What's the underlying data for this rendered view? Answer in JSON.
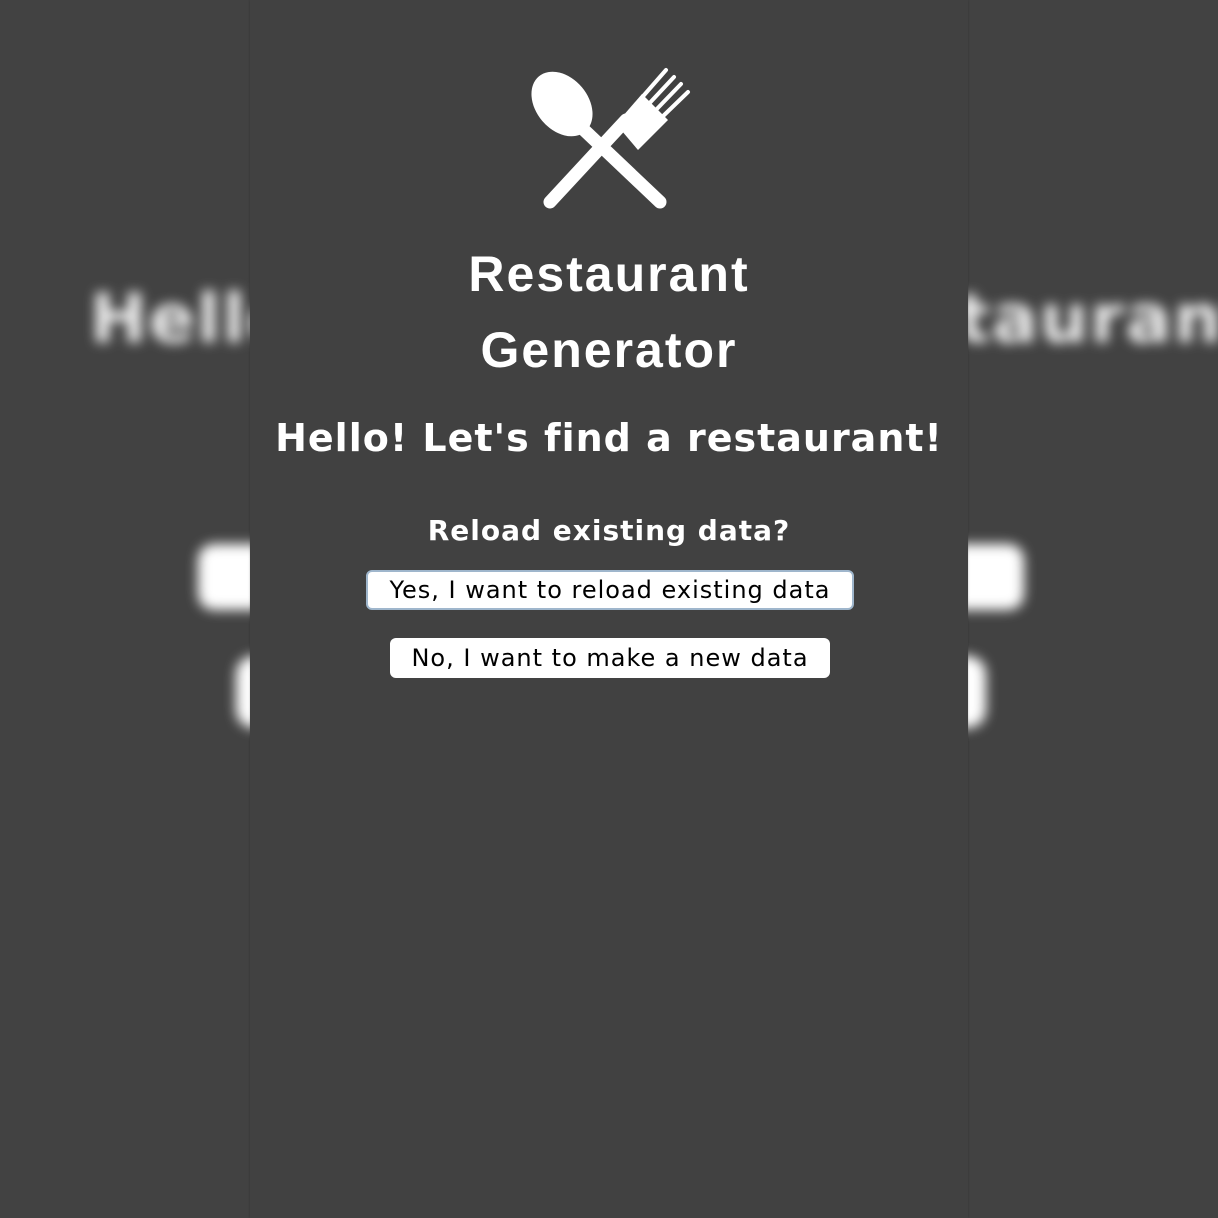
{
  "app": {
    "title_line1": "Restaurant",
    "title_line2": "Generator",
    "logo_icon": "spoon-fork-icon"
  },
  "welcome": {
    "greeting": "Hello! Let's find a restaurant!",
    "question": "Reload existing data?"
  },
  "actions": {
    "reload_label": "Yes, I want to reload existing data",
    "new_label": "No, I want to make a new data"
  },
  "colors": {
    "background": "#414141",
    "text": "#ffffff",
    "button_bg": "#ffffff",
    "button_text": "#000000",
    "focus_border": "#9fb6cc"
  }
}
